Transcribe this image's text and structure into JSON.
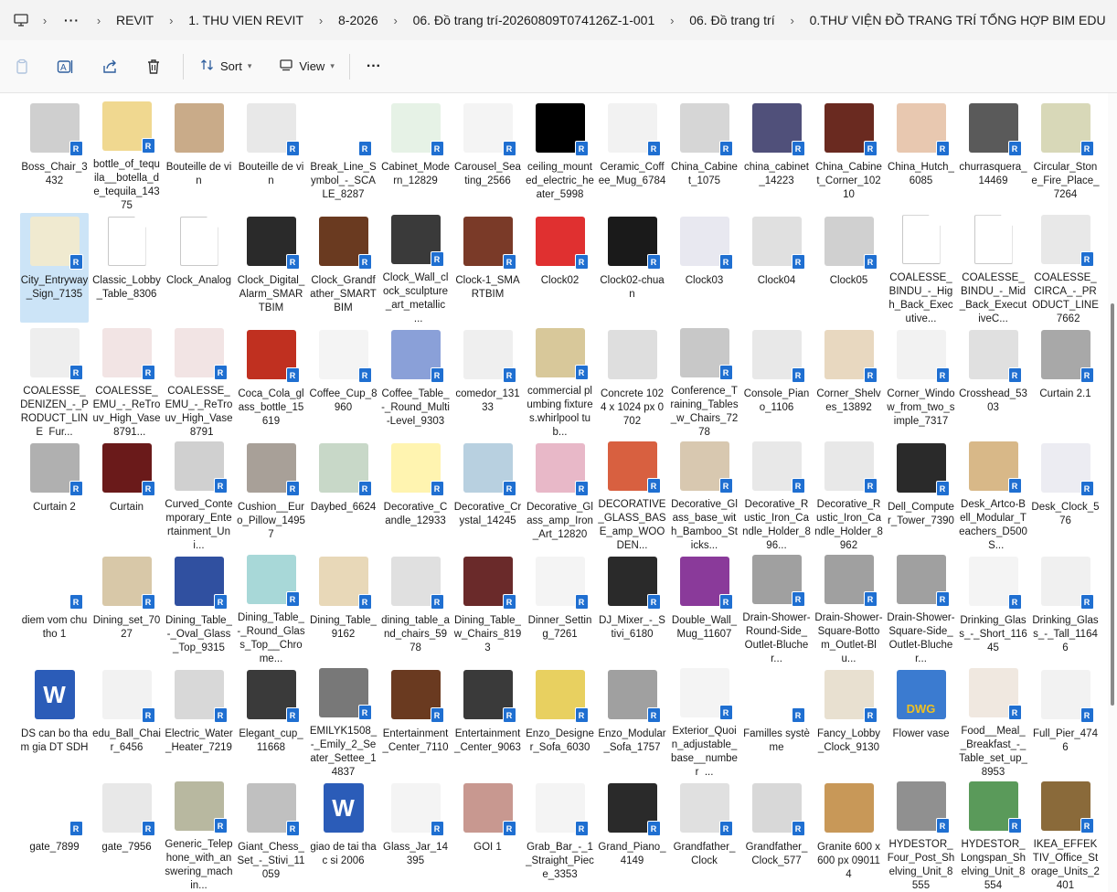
{
  "breadcrumb": {
    "items": [
      "REVIT",
      "1. THU VIEN REVIT",
      "8-2026",
      "06. Đồ trang trí-20260809T074126Z-1-001",
      "06. Đồ trang trí",
      "0.THƯ VIỆN ĐỒ TRANG TRÍ TỔNG HỢP BIM EDU"
    ],
    "more_label": "···",
    "separator": "›"
  },
  "toolbar": {
    "sort_label": "Sort",
    "view_label": "View",
    "more_label": "···"
  },
  "files": [
    {
      "name": "Boss_Chair_3432",
      "color": "#cfcfcf",
      "badge": true
    },
    {
      "name": "bottle_of_tequila__botella_de_tequila_14375",
      "color": "#f0d890",
      "badge": true
    },
    {
      "name": "Bouteille de vin",
      "color": "#c9ab89",
      "badge": false
    },
    {
      "name": "Bouteille de vin",
      "color": "#e8e8e8",
      "badge": true
    },
    {
      "name": "Break_Line_Symbol_-_SCALE_8287",
      "color": "#ffffff",
      "badge": true
    },
    {
      "name": "Cabinet_Modern_12829",
      "color": "#e6f2e6",
      "badge": true
    },
    {
      "name": "Carousel_Seating_2566",
      "color": "#f4f4f4",
      "badge": true
    },
    {
      "name": "ceiling_mounted_electric_heater_5998",
      "color": "#000000",
      "badge": true
    },
    {
      "name": "Ceramic_Coffee_Mug_6784",
      "color": "#f2f2f2",
      "badge": true
    },
    {
      "name": "China_Cabinet_1075",
      "color": "#d6d6d6",
      "badge": true
    },
    {
      "name": "china_cabinet_14223",
      "color": "#50507a",
      "badge": true
    },
    {
      "name": "China_Cabinet_Corner_10210",
      "color": "#6a2a20",
      "badge": true
    },
    {
      "name": "China_Hutch_6085",
      "color": "#e8c8b0",
      "badge": true
    },
    {
      "name": "churrasquera_14469",
      "color": "#5a5a5a",
      "badge": true
    },
    {
      "name": "Circular_Stone_Fire_Place_7264",
      "color": "#d8d8b8",
      "badge": true
    },
    {
      "name": "City_Entryway_Sign_7135",
      "color": "#f0ead0",
      "badge": true,
      "selected": true
    },
    {
      "name": "Classic_Lobby_Table_8306",
      "color": "doc",
      "badge": false
    },
    {
      "name": "Clock_Analog",
      "color": "doc",
      "badge": false
    },
    {
      "name": "Clock_Digital_Alarm_SMARTBIM",
      "color": "#2a2a2a",
      "badge": true
    },
    {
      "name": "Clock_Grandfather_SMARTBIM",
      "color": "#6a3a20",
      "badge": true
    },
    {
      "name": "Clock_Wall_clock_sculpture_art_metallic_...",
      "color": "#3a3a3a",
      "badge": true
    },
    {
      "name": "Clock-1_SMARTBIM",
      "color": "#7a3a28",
      "badge": true
    },
    {
      "name": "Clock02",
      "color": "#e03030",
      "badge": true
    },
    {
      "name": "Clock02-chuan",
      "color": "#1a1a1a",
      "badge": true
    },
    {
      "name": "Clock03",
      "color": "#e8e8f0",
      "badge": true
    },
    {
      "name": "Clock04",
      "color": "#e0e0e0",
      "badge": true
    },
    {
      "name": "Clock05",
      "color": "#d0d0d0",
      "badge": true
    },
    {
      "name": "COALESSE_BINDU_-_High_Back_Executive...",
      "color": "doc",
      "badge": false
    },
    {
      "name": "COALESSE_BINDU_-_Mid_Back_ExecutiveC...",
      "color": "doc",
      "badge": false
    },
    {
      "name": "COALESSE_CIRCA_-_PRODUCT_LINE_7662",
      "color": "#e8e8e8",
      "badge": true
    },
    {
      "name": "COALESSE_DENIZEN_-_PRODUCT_LINE_Fur...",
      "color": "#eeeeee",
      "badge": true
    },
    {
      "name": "COALESSE_EMU_-_ReTrouv_High_Vase_8791...",
      "color": "#f2e4e4",
      "badge": true
    },
    {
      "name": "COALESSE_EMU_-_ReTrouv_High_Vase_8791",
      "color": "#f2e4e4",
      "badge": true
    },
    {
      "name": "Coca_Cola_glass_bottle_15619",
      "color": "#c03020",
      "badge": true
    },
    {
      "name": "Coffee_Cup_8960",
      "color": "#f4f4f4",
      "badge": true
    },
    {
      "name": "Coffee_Table_-_Round_Multi-Level_9303",
      "color": "#8aa0d8",
      "badge": true
    },
    {
      "name": "comedor_13133",
      "color": "#efefef",
      "badge": true
    },
    {
      "name": "commercial plumbing fixtures.whirlpool tub...",
      "color": "#d8c89a",
      "badge": true
    },
    {
      "name": "Concrete 1024 x 1024 px 0702",
      "color": "#dedede",
      "badge": false
    },
    {
      "name": "Conference_Training_Tables_w_Chairs_7278",
      "color": "#c8c8c8",
      "badge": true
    },
    {
      "name": "Console_Piano_1106",
      "color": "#e8e8e8",
      "badge": true
    },
    {
      "name": "Corner_Shelves_13892",
      "color": "#e8d8c0",
      "badge": true
    },
    {
      "name": "Corner_Window_from_two_simple_7317",
      "color": "#f2f2f2",
      "badge": true
    },
    {
      "name": "Crosshead_5303",
      "color": "#e0e0e0",
      "badge": true
    },
    {
      "name": "Curtain 2.1",
      "color": "#a8a8a8",
      "badge": true
    },
    {
      "name": "Curtain 2",
      "color": "#b0b0b0",
      "badge": true
    },
    {
      "name": "Curtain",
      "color": "#6a1a1a",
      "badge": true
    },
    {
      "name": "Curved_Contemporary_Entertainment_Uni...",
      "color": "#d0d0d0",
      "badge": true
    },
    {
      "name": "Cushion__Euro_Pillow_14957",
      "color": "#a8a098",
      "badge": true
    },
    {
      "name": "Daybed_6624",
      "color": "#c8d8c8",
      "badge": true
    },
    {
      "name": "Decorative_Candle_12933",
      "color": "#fff4b0",
      "badge": true
    },
    {
      "name": "Decorative_Crystal_14245",
      "color": "#b8d0e0",
      "badge": true
    },
    {
      "name": "Decorative_Glass_amp_Iron_Art_12820",
      "color": "#e8b8c8",
      "badge": true
    },
    {
      "name": "DECORATIVE_GLASS_BASE_amp_WOODEN...",
      "color": "#d86040",
      "badge": true
    },
    {
      "name": "Decorative_Glass_base_with_Bamboo_Sticks...",
      "color": "#d8c8b0",
      "badge": true
    },
    {
      "name": "Decorative_Rustic_Iron_Candle_Holder_896...",
      "color": "#e8e8e8",
      "badge": true
    },
    {
      "name": "Decorative_Rustic_Iron_Candle_Holder_8962",
      "color": "#e8e8e8",
      "badge": true
    },
    {
      "name": "Dell_Computer_Tower_7390",
      "color": "#2a2a2a",
      "badge": true
    },
    {
      "name": "Desk_Artco-Bell_Modular_Teachers_D500_S...",
      "color": "#d8b888",
      "badge": true
    },
    {
      "name": "Desk_Clock_576",
      "color": "#ececf2",
      "badge": true
    },
    {
      "name": "diem vom chu tho 1",
      "color": "#ffffff",
      "badge": true
    },
    {
      "name": "Dining_set_7027",
      "color": "#d8c8a8",
      "badge": true
    },
    {
      "name": "Dining_Table_-_Oval_Glass_Top_9315",
      "color": "#3050a0",
      "badge": true
    },
    {
      "name": "Dining_Table_-_Round_Glass_Top__Chrome...",
      "color": "#a8d8d8",
      "badge": true
    },
    {
      "name": "Dining_Table_9162",
      "color": "#e8d8b8",
      "badge": true
    },
    {
      "name": "dining_table_and_chairs_5978",
      "color": "#e0e0e0",
      "badge": true
    },
    {
      "name": "Dining_Table_w_Chairs_8193",
      "color": "#6a2a2a",
      "badge": true
    },
    {
      "name": "Dinner_Setting_7261",
      "color": "#f4f4f4",
      "badge": true
    },
    {
      "name": "DJ_Mixer_-_Stivi_6180",
      "color": "#2a2a2a",
      "badge": true
    },
    {
      "name": "Double_Wall_Mug_11607",
      "color": "#8a3a9a",
      "badge": true
    },
    {
      "name": "Drain-Shower-Round-Side_Outlet-Blucher...",
      "color": "#a0a0a0",
      "badge": true
    },
    {
      "name": "Drain-Shower-Square-Bottom_Outlet-Blu...",
      "color": "#a0a0a0",
      "badge": true
    },
    {
      "name": "Drain-Shower-Square-Side_Outlet-Blucher...",
      "color": "#a0a0a0",
      "badge": true
    },
    {
      "name": "Drinking_Glass_-_Short_11645",
      "color": "#f4f4f4",
      "badge": true
    },
    {
      "name": "Drinking_Glass_-_Tall_11646",
      "color": "#f0f0f0",
      "badge": true
    },
    {
      "name": "DS can bo tham gia DT SDH",
      "color": "word",
      "badge": false
    },
    {
      "name": "edu_Ball_Chair_6456",
      "color": "#f2f2f2",
      "badge": true
    },
    {
      "name": "Electric_Water_Heater_7219",
      "color": "#d8d8d8",
      "badge": true
    },
    {
      "name": "Elegant_cup_11668",
      "color": "#3a3a3a",
      "badge": true
    },
    {
      "name": "EMILYK1508_-_Emily_2_Seater_Settee_14837",
      "color": "#787878",
      "badge": true
    },
    {
      "name": "Entertainment_Center_7110",
      "color": "#6a3a20",
      "badge": true
    },
    {
      "name": "Entertainment_Center_9063",
      "color": "#3a3a3a",
      "badge": true
    },
    {
      "name": "Enzo_Designer_Sofa_6030",
      "color": "#e8d060",
      "badge": true
    },
    {
      "name": "Enzo_Modular_Sofa_1757",
      "color": "#a0a0a0",
      "badge": true
    },
    {
      "name": "Exterior_Quoin_adjustable_base__number_...",
      "color": "#f4f4f4",
      "badge": true
    },
    {
      "name": "Familles système",
      "color": "#ffffff",
      "badge": true
    },
    {
      "name": "Fancy_Lobby_Clock_9130",
      "color": "#e8e0d0",
      "badge": true
    },
    {
      "name": "Flower vase",
      "color": "dwg",
      "badge": false
    },
    {
      "name": "Food__Meal__Breakfast_-_Table_set_up_8953",
      "color": "#f0e8e0",
      "badge": true
    },
    {
      "name": "Full_Pier_4746",
      "color": "#f2f2f2",
      "badge": true
    },
    {
      "name": "gate_7899",
      "color": "#ffffff",
      "badge": true
    },
    {
      "name": "gate_7956",
      "color": "#e8e8e8",
      "badge": true
    },
    {
      "name": "Generic_Telephone_with_answering_machin...",
      "color": "#b8b8a0",
      "badge": true
    },
    {
      "name": "Giant_Chess_Set_-_Stivi_11059",
      "color": "#c0c0c0",
      "badge": true
    },
    {
      "name": "giao de tai thac si 2006",
      "color": "word",
      "badge": false
    },
    {
      "name": "Glass_Jar_14395",
      "color": "#f4f4f4",
      "badge": true
    },
    {
      "name": "GOI 1",
      "color": "#c89890",
      "badge": true
    },
    {
      "name": "Grab_Bar_-_1_Straight_Piece_3353",
      "color": "#f4f4f4",
      "badge": true
    },
    {
      "name": "Grand_Piano_4149",
      "color": "#2a2a2a",
      "badge": true
    },
    {
      "name": "Grandfather_Clock",
      "color": "#e0e0e0",
      "badge": true
    },
    {
      "name": "Grandfather_Clock_577",
      "color": "#d8d8d8",
      "badge": true
    },
    {
      "name": "Granite 600 x 600 px 090114",
      "color": "#c89858",
      "badge": false
    },
    {
      "name": "HYDESTOR_Four_Post_Shelving_Unit_8555",
      "color": "#909090",
      "badge": true
    },
    {
      "name": "HYDESTOR_Longspan_Shelving_Unit_8554",
      "color": "#5a9a5a",
      "badge": true
    },
    {
      "name": "IKEA_EFFEKTIV_Office_Storage_Units_2401",
      "color": "#8a6a3a",
      "badge": true
    }
  ],
  "badge_text": "R",
  "icons": {
    "computer": "computer-icon",
    "copy": "copy-icon",
    "rename": "rename-icon",
    "share": "share-icon",
    "delete": "delete-icon",
    "sort": "sort-icon",
    "view": "view-icon"
  }
}
